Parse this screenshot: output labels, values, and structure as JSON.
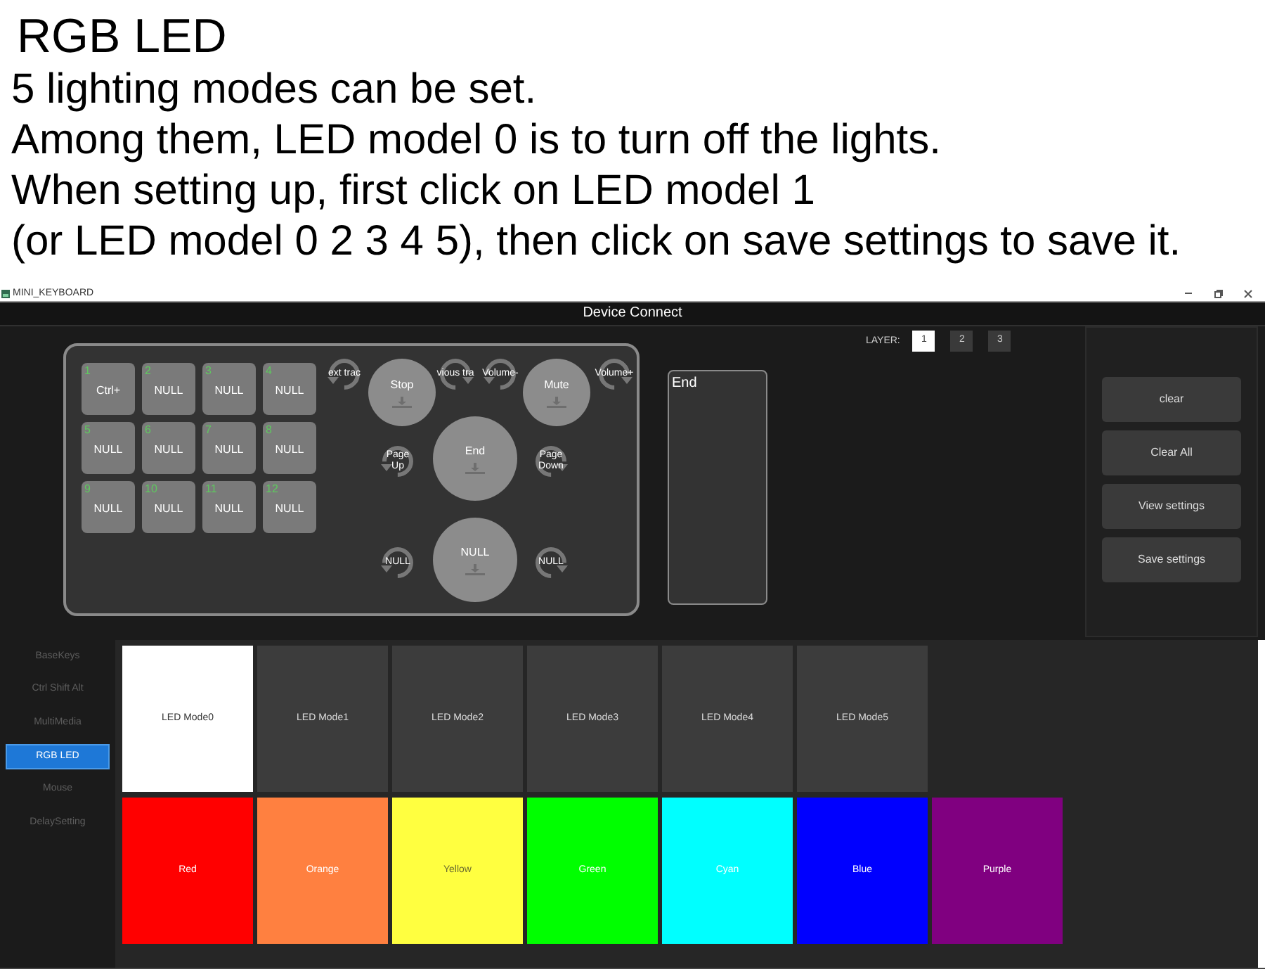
{
  "heading": {
    "title": "RGB LED",
    "lines": [
      "5 lighting modes can be set.",
      "Among them, LED model 0 is to turn off the lights.",
      "When setting up, first click on LED model 1",
      "(or LED model 0 2 3 4 5), then click on save settings to save it."
    ]
  },
  "window": {
    "title": "MINI_KEYBOARD",
    "header": "Device Connect"
  },
  "keys": [
    {
      "number": "1",
      "label": "Ctrl+"
    },
    {
      "number": "2",
      "label": "NULL"
    },
    {
      "number": "3",
      "label": "NULL"
    },
    {
      "number": "4",
      "label": "NULL"
    },
    {
      "number": "5",
      "label": "NULL"
    },
    {
      "number": "6",
      "label": "NULL"
    },
    {
      "number": "7",
      "label": "NULL"
    },
    {
      "number": "8",
      "label": "NULL"
    },
    {
      "number": "9",
      "label": "NULL"
    },
    {
      "number": "10",
      "label": "NULL"
    },
    {
      "number": "11",
      "label": "NULL"
    },
    {
      "number": "12",
      "label": "NULL"
    }
  ],
  "knobs": [
    {
      "kind": "turn_left",
      "label": "ext trac"
    },
    {
      "kind": "press",
      "label": "Stop"
    },
    {
      "kind": "turn_right",
      "label": "vious tra"
    },
    {
      "kind": "turn_left",
      "label": "Volume-"
    },
    {
      "kind": "press",
      "label": "Mute"
    },
    {
      "kind": "turn_right",
      "label": "Volume+"
    },
    {
      "kind": "turn_left",
      "label": "Page Up"
    },
    {
      "kind": "press",
      "label": "End"
    },
    {
      "kind": "turn_right",
      "label": "Page Down"
    },
    {
      "kind": "turn_left",
      "label": "NULL"
    },
    {
      "kind": "press",
      "label": "NULL"
    },
    {
      "kind": "turn_right",
      "label": "NULL"
    }
  ],
  "key_value": {
    "value": "End"
  },
  "layer": {
    "label": "LAYER:",
    "buttons": [
      {
        "label": "1",
        "selected": true
      },
      {
        "label": "2",
        "selected": false
      },
      {
        "label": "3",
        "selected": false
      }
    ]
  },
  "actions": [
    "clear",
    "Clear All",
    "View settings",
    "Save settings"
  ],
  "sidebar": {
    "items": [
      {
        "label": "BaseKeys",
        "selected": false
      },
      {
        "label": "Ctrl Shift Alt",
        "selected": false
      },
      {
        "label": "MultiMedia",
        "selected": false
      },
      {
        "label": "RGB LED",
        "selected": true
      },
      {
        "label": "Mouse",
        "selected": false
      },
      {
        "label": "DelaySetting",
        "selected": false
      }
    ]
  },
  "led_modes": [
    {
      "label": "LED Mode0",
      "selected": true
    },
    {
      "label": "LED Mode1",
      "selected": false
    },
    {
      "label": "LED Mode2",
      "selected": false
    },
    {
      "label": "LED Mode3",
      "selected": false
    },
    {
      "label": "LED Mode4",
      "selected": false
    },
    {
      "label": "LED Mode5",
      "selected": false
    }
  ],
  "colors": [
    {
      "label": "Red",
      "color": "#ff0000"
    },
    {
      "label": "Orange",
      "color": "#ff8040"
    },
    {
      "label": "Yellow",
      "color": "#ffff40"
    },
    {
      "label": "Green",
      "color": "#00ff00"
    },
    {
      "label": "Cyan",
      "color": "#00ffff"
    },
    {
      "label": "Blue",
      "color": "#0000ff"
    },
    {
      "label": "Purple",
      "color": "#800080"
    }
  ]
}
